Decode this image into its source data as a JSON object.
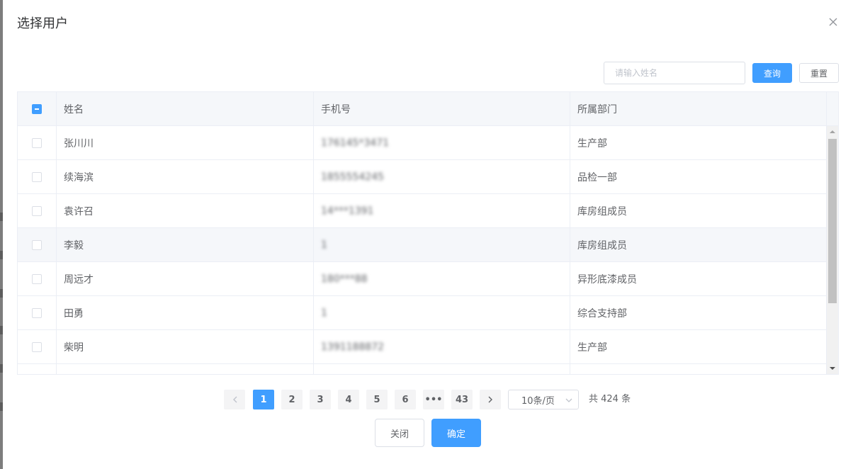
{
  "dialog": {
    "title": "选择用户"
  },
  "search": {
    "placeholder": "请输入姓名",
    "value": "",
    "query_label": "查询",
    "reset_label": "重置"
  },
  "table": {
    "columns": [
      "姓名",
      "手机号",
      "所属部门"
    ],
    "rows": [
      {
        "name": "张川川",
        "phone": "176145*3471",
        "dept": "生产部"
      },
      {
        "name": "续海滨",
        "phone": "1855554245",
        "dept": "品检一部"
      },
      {
        "name": "袁许召",
        "phone": "14***1391",
        "dept": "库房组成员"
      },
      {
        "name": "李毅",
        "phone": "1",
        "dept": "库房组成员"
      },
      {
        "name": "周远才",
        "phone": "180***88",
        "dept": "异形底漆成员"
      },
      {
        "name": "田勇",
        "phone": "1",
        "dept": "综合支持部"
      },
      {
        "name": "柴明",
        "phone": "1391188872",
        "dept": "生产部"
      },
      {
        "name": "",
        "phone": "",
        "dept": ""
      }
    ]
  },
  "pagination": {
    "prev_icon": "chevron-left-icon",
    "next_icon": "chevron-right-icon",
    "pages": [
      "1",
      "2",
      "3",
      "4",
      "5",
      "6",
      "•••",
      "43"
    ],
    "current_page": "1",
    "page_size": "10条/页",
    "total": "共 424 条"
  },
  "footer": {
    "close_label": "关闭",
    "confirm_label": "确定"
  },
  "colors": {
    "primary": "#409eff",
    "border": "#dcdfe6",
    "text": "#606266",
    "header_bg": "#f5f7fa"
  }
}
